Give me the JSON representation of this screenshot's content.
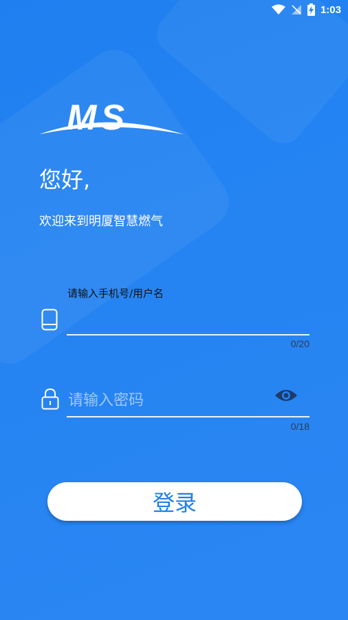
{
  "status_bar": {
    "time": "1:03"
  },
  "brand": {
    "logo_text": "MS"
  },
  "header": {
    "greeting": "您好,",
    "welcome": "欢迎来到明厦智慧燃气"
  },
  "username": {
    "label": "请输入手机号/用户名",
    "value": "",
    "counter": "0/20"
  },
  "password": {
    "placeholder": "请输入密码",
    "value": "",
    "counter": "0/18"
  },
  "login_button": {
    "label": "登录"
  },
  "colors": {
    "background": "#2584f2",
    "accent_text": "#1e7fe8",
    "eye_icon": "#1d3b6b"
  }
}
